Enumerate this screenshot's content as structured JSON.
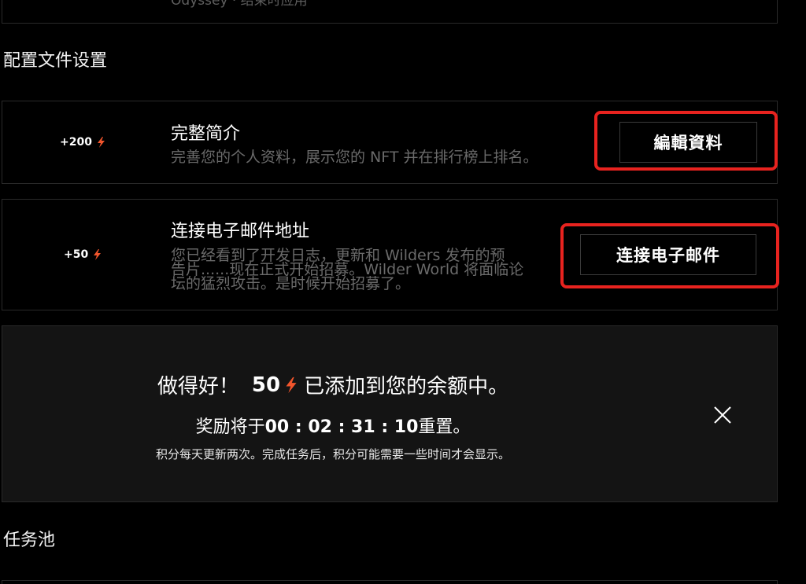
{
  "top_card": {
    "cut_text": "Odyssey · 结束时应用"
  },
  "profile_section": {
    "title": "配置文件设置"
  },
  "tasks": [
    {
      "points": "+200",
      "title": "完整简介",
      "description": "完善您的个人资料，展示您的 NFT 并在排行榜上排名。",
      "button_label": "編輯資料"
    },
    {
      "points": "+50",
      "title": "连接电子邮件地址",
      "description_line1": "您已经看到了开发日志，更新和 Wilders 发布的预",
      "description_line2": "告片......现在正式开始招募。Wilder World 将面临论",
      "description_line3": "坛的猛烈攻击。是时候开始招募了。",
      "button_label": "连接电子邮件"
    }
  ],
  "reward_banner": {
    "prefix": "做得好！",
    "amount": "50",
    "suffix": "已添加到您的余额中。",
    "reset_prefix": "奖励将于",
    "reset_timer": "00 : 02 : 31 : 10",
    "reset_suffix": "重置。",
    "note": "积分每天更新两次。完成任务后，积分可能需要一些时间才会显示。"
  },
  "task_pool_section": {
    "title": "任务池"
  },
  "colors": {
    "accent_orange": "#f2552c",
    "highlight_red": "#e8231f",
    "muted_text": "#6a6a6a"
  },
  "icons": {
    "points": "lightning-bolt-icon",
    "close": "close-icon"
  }
}
